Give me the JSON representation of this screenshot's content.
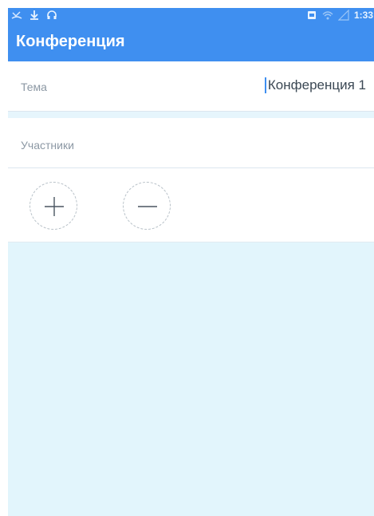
{
  "app": {
    "title": "Конференция"
  },
  "status_bar": {
    "time": "1:33",
    "icons": [
      "missed-call-icon",
      "download-icon",
      "headset-icon",
      "sim-icon",
      "wifi-icon",
      "signal-icon"
    ]
  },
  "form": {
    "topic_label": "Тема",
    "topic_value": "Конференция 1",
    "participants_label": "Участники"
  },
  "colors": {
    "accent": "#3f8ff0",
    "list_background": "#e2f5fc",
    "label": "#8c98a4"
  }
}
